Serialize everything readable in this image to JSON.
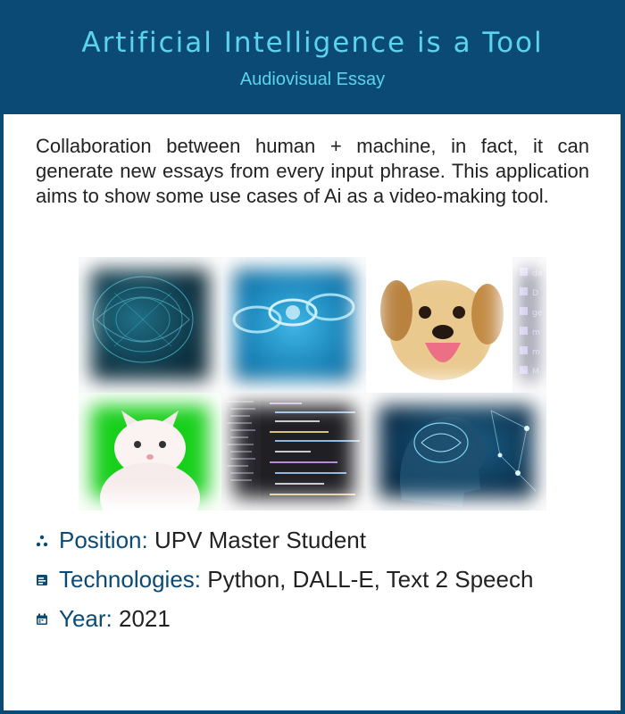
{
  "header": {
    "title": "Artificial Intelligence is a Tool",
    "subtitle": "Audiovisual Essay"
  },
  "description": "Collaboration between human + machine, in fact, it can generate new essays from every input phrase. This application aims to show some use cases of Ai as a video-making tool.",
  "collage": {
    "tiles": [
      "brain-wireframe",
      "digital-chain",
      "puppy",
      "menu-strip",
      "white-cat-green-screen",
      "code-editor",
      "ai-head"
    ],
    "menu_items": [
      "da",
      "D",
      "ge",
      "m",
      "m",
      "M"
    ]
  },
  "details": [
    {
      "icon": "network-icon",
      "label": "Position:",
      "value": "UPV Master Student"
    },
    {
      "icon": "code-icon",
      "label": "Technologies:",
      "value": "Python, DALL-E, Text 2 Speech"
    },
    {
      "icon": "calendar-icon",
      "label": "Year:",
      "value": "2021"
    }
  ],
  "colors": {
    "background": "#0b4a74",
    "accent": "#5cd3ee",
    "card": "#ffffff"
  }
}
